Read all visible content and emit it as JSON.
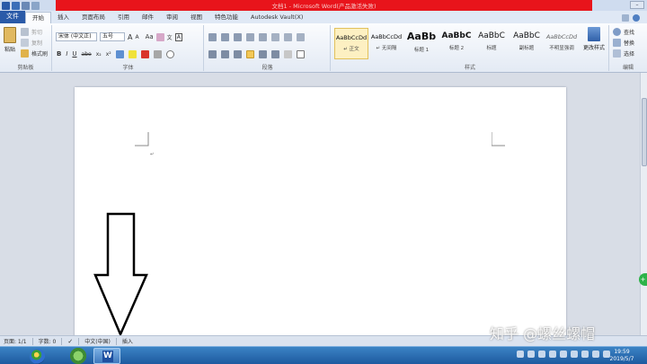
{
  "window": {
    "title": "文档1 - Microsoft Word(产品激活失败)"
  },
  "tabs": [
    "文件",
    "开始",
    "插入",
    "页面布局",
    "引用",
    "邮件",
    "审阅",
    "视图",
    "特色功能",
    "Autodesk Vault(X)"
  ],
  "clipboard": {
    "paste": "粘贴",
    "cut": "剪切",
    "copy": "复制",
    "format_painter": "格式刷",
    "label": "剪贴板"
  },
  "font": {
    "name": "宋体 (中文正)",
    "size": "五号",
    "grow": "A",
    "shrink": "A",
    "aa": "Aa",
    "wen": "文",
    "A_box": "A",
    "bold": "B",
    "italic": "I",
    "underline": "U",
    "strike": "abe",
    "sub": "x₂",
    "sup": "x²",
    "label": "字体"
  },
  "paragraph": {
    "label": "段落"
  },
  "styles": {
    "items": [
      {
        "sample": "AaBbCcDd",
        "name": "↵ 正文"
      },
      {
        "sample": "AaBbCcDd",
        "name": "↵ 无间隔"
      },
      {
        "sample": "AaBb",
        "name": "标题 1"
      },
      {
        "sample": "AaBbC",
        "name": "标题 2"
      },
      {
        "sample": "AaBbC",
        "name": "标题"
      },
      {
        "sample": "AaBbC",
        "name": "副标题"
      },
      {
        "sample": "AaBbCcDd",
        "name": "不明显强调"
      }
    ],
    "change_label": "更改样式",
    "label": "样式"
  },
  "editing": {
    "find": "查找",
    "replace": "替换",
    "select": "选择",
    "label": "编辑"
  },
  "statusbar": {
    "page": "页面: 1/1",
    "words": "字数: 0",
    "language": "中文(中国)",
    "mode": "插入"
  },
  "watermark": "知乎 @螺丝螺帽",
  "taskbar": {
    "time": "19:59",
    "date": "2019/5/7",
    "word_letter": "W"
  }
}
